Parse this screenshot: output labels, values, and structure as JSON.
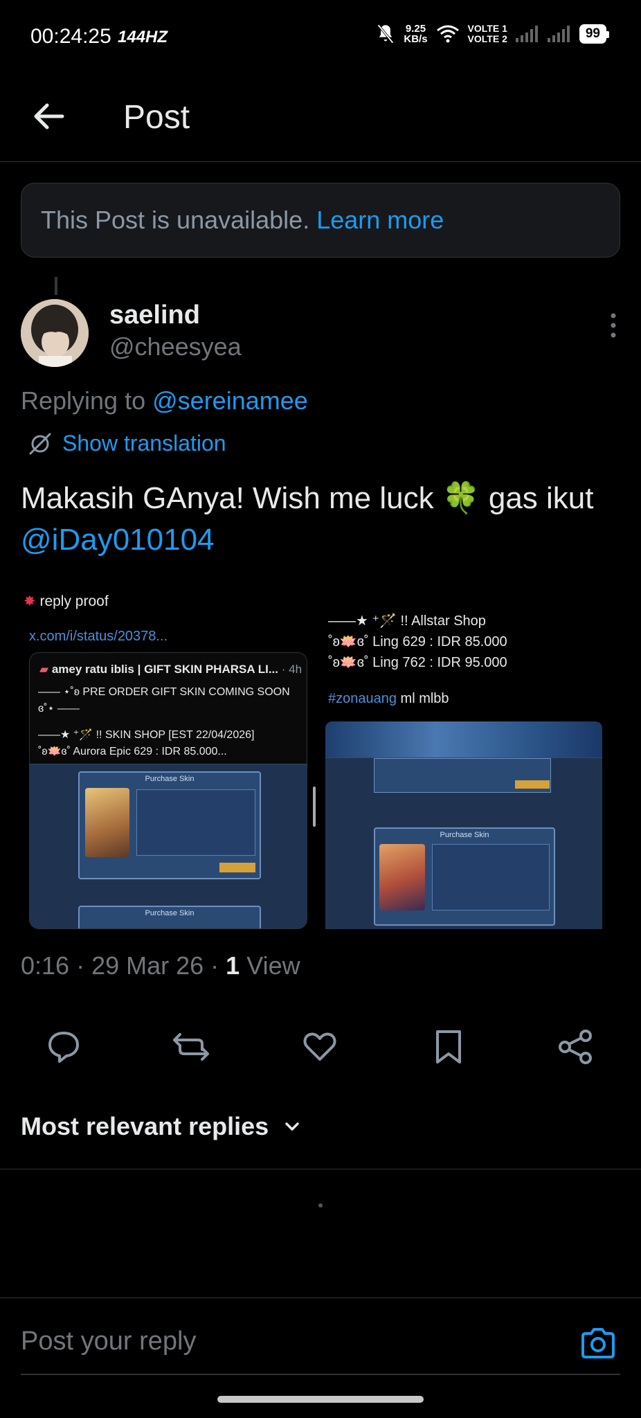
{
  "status_bar": {
    "time": "00:24:25",
    "refresh_rate": "144HZ",
    "net_speed_value": "9.25",
    "net_speed_unit": "KB/s",
    "network_1": "VOLTE 1",
    "network_2": "VOLTE 2",
    "battery": "99"
  },
  "header": {
    "title": "Post"
  },
  "notice": {
    "text": "This Post is unavailable.",
    "link": "Learn more"
  },
  "author": {
    "display_name": "saelind",
    "handle": "@cheesyea"
  },
  "replying": {
    "prefix": "Replying to",
    "handle": "@sereinamee"
  },
  "translation": {
    "label": "Show translation"
  },
  "post": {
    "text": "Makasih GAnya! Wish me luck 🍀 gas ikut",
    "mention": "@iDay010104"
  },
  "media": {
    "left": {
      "label": "reply proof",
      "link": "x.com/i/status/20378...",
      "quote_author": "amey ratu iblis | GIFT SKIN PHARSA LI...",
      "quote_time": "· 4h",
      "line1": "—— ⋆˚ʚ PRE ORDER GIFT SKIN COMING SOON",
      "line2": "ɞ˚⋆ ——",
      "line3": "——★ ⁺🪄 !! SKIN SHOP [EST 22/04/2026]",
      "line4": "˚ʚ🪷ɞ˚ Aurora Epic 629 : IDR 85.000...",
      "dialog_title": "Purchase Skin",
      "dialog_title_2": "Purchase Skin"
    },
    "right": {
      "line1": "——★ ⁺🪄 !! Allstar Shop",
      "line2": "˚ʚ🪷ɞ˚ Ling 629 : IDR 85.000",
      "line3": "˚ʚ🪷ɞ˚ Ling 762 : IDR 95.000",
      "hashtag": "#zonauang",
      "tags": "ml mlbb",
      "dialog_title": "Purchase Skin"
    }
  },
  "meta": {
    "time": "0:16",
    "date": "29 Mar 26",
    "views_count": "1",
    "views_label": "View"
  },
  "replies": {
    "sort_label": "Most relevant replies"
  },
  "reply_input": {
    "placeholder": "Post your reply"
  },
  "colors": {
    "background": "#000000",
    "link": "#1d9bf0",
    "muted": "#71767b",
    "text": "#e7e9ea"
  }
}
